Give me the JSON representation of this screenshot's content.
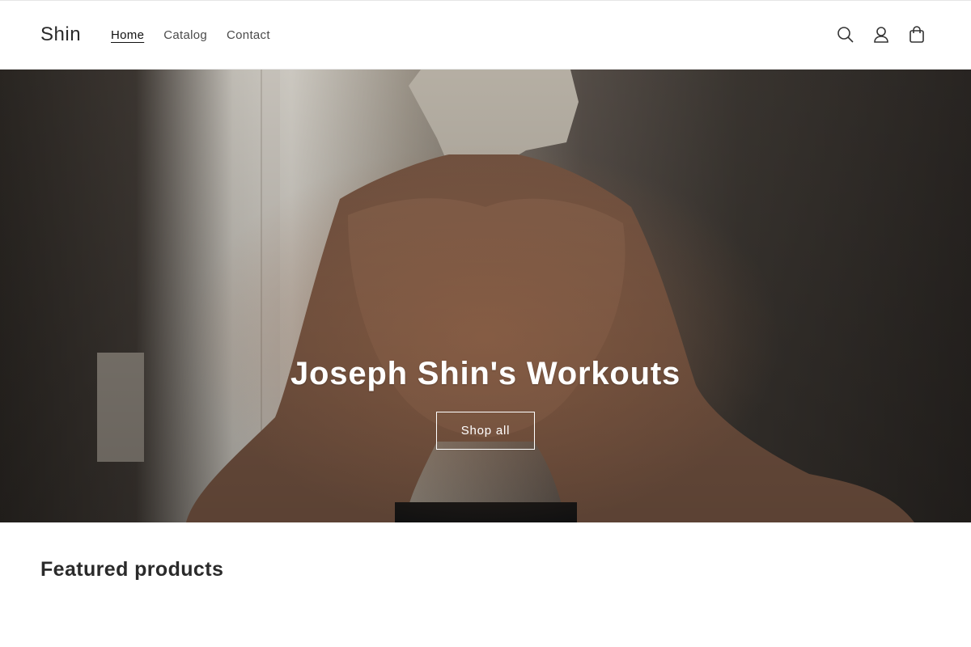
{
  "header": {
    "logo": "Shin",
    "nav": [
      {
        "label": "Home",
        "active": true
      },
      {
        "label": "Catalog",
        "active": false
      },
      {
        "label": "Contact",
        "active": false
      }
    ],
    "icons": [
      "search-icon",
      "account-icon",
      "cart-icon"
    ]
  },
  "hero": {
    "title": "Joseph Shin's Workouts",
    "button_label": "Shop all"
  },
  "featured": {
    "heading": "Featured products"
  }
}
